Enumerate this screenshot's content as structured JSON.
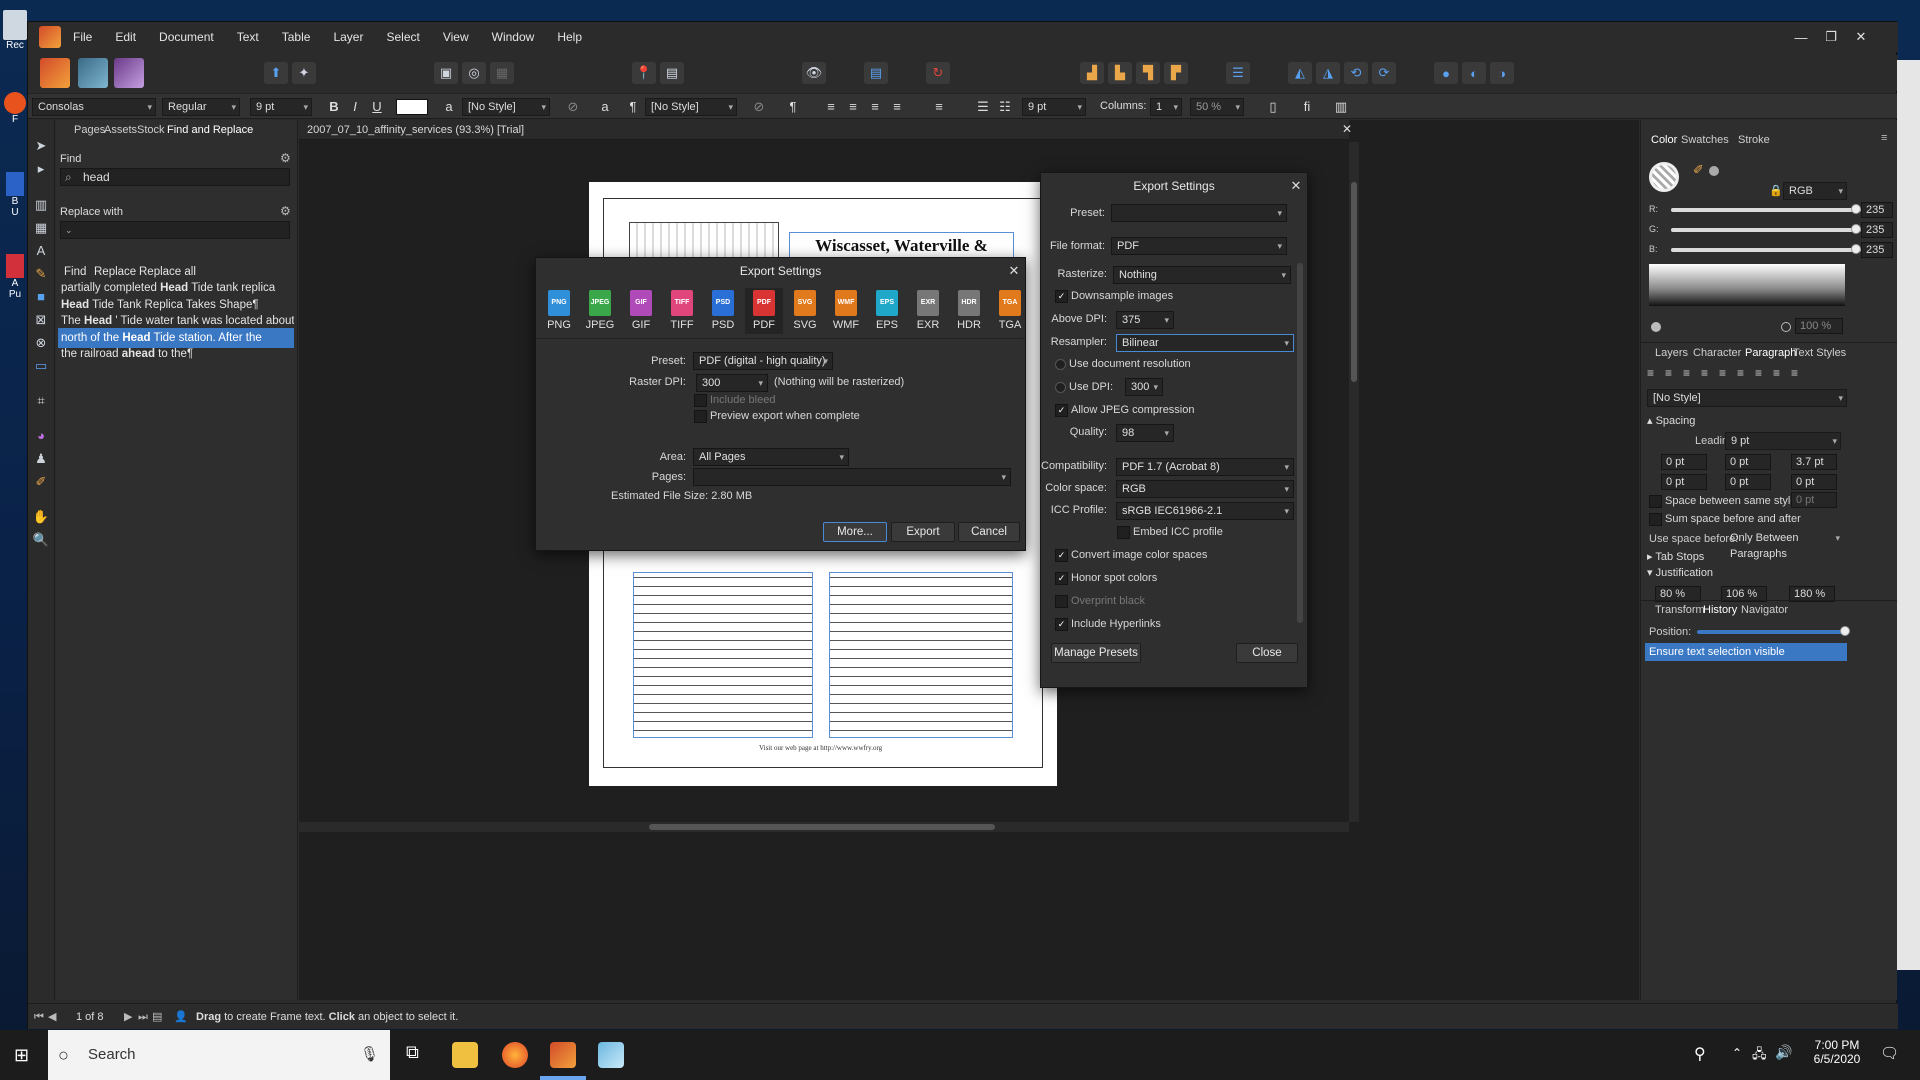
{
  "desktop": {
    "icons": [
      "Rec",
      "F",
      "B\nU",
      "A\nPu"
    ]
  },
  "app": {
    "menu": [
      "File",
      "Edit",
      "Document",
      "Text",
      "Table",
      "Layer",
      "Select",
      "View",
      "Window",
      "Help"
    ],
    "context": {
      "font": "Consolas",
      "style": "Regular",
      "size": "9 pt",
      "char_style": "[No Style]",
      "para_style": "[No Style]",
      "leading": "9 pt",
      "columns_label": "Columns:",
      "columns": "1",
      "gutter": "50 %"
    },
    "left_panel": {
      "tabs": [
        "Pages",
        "Assets",
        "Stock",
        "Find and Replace"
      ],
      "find_label": "Find",
      "find_value": "head",
      "replace_label": "Replace with",
      "buttons": [
        "Find",
        "Replace",
        "Replace all"
      ],
      "results": [
        {
          "pre": "partially completed ",
          "hit": "Head",
          "post": " Tide tank replica"
        },
        {
          "pre": "",
          "hit": "Head",
          "post": " Tide Tank Replica Takes Shape¶"
        },
        {
          "pre": "The ",
          "hit": "Head",
          "post": " ' Tide water tank was located about"
        },
        {
          "pre": "north of the ",
          "hit": "Head",
          "post": " Tide station. After the"
        },
        {
          "pre": "the railroad ",
          "hit": "ahead",
          "post": " to the¶"
        }
      ]
    },
    "document": {
      "tab_title": "2007_07_10_affinity_services (93.3%) [Trial]",
      "headline": "Wiscasset, Waterville & Farmington",
      "footer_line": "Visit our web page at http://www.wwfry.org"
    },
    "export_dialog": {
      "title": "Export Settings",
      "formats": [
        {
          "name": "PNG",
          "color": "#2f8fd9"
        },
        {
          "name": "JPEG",
          "color": "#3aa84a"
        },
        {
          "name": "GIF",
          "color": "#b04ab8"
        },
        {
          "name": "TIFF",
          "color": "#e0457b"
        },
        {
          "name": "PSD",
          "color": "#2a6fd6"
        },
        {
          "name": "PDF",
          "color": "#d93434"
        },
        {
          "name": "SVG",
          "color": "#e07a1c"
        },
        {
          "name": "WMF",
          "color": "#e0781c"
        },
        {
          "name": "EPS",
          "color": "#1fa8c8"
        },
        {
          "name": "EXR",
          "color": "#777777"
        },
        {
          "name": "HDR",
          "color": "#777777"
        },
        {
          "name": "TGA",
          "color": "#e07a1c"
        }
      ],
      "preset_label": "Preset:",
      "preset": "PDF (digital - high quality)",
      "raster_dpi_label": "Raster DPI:",
      "raster_dpi": "300",
      "raster_note": "(Nothing will be rasterized)",
      "include_bleed": "Include bleed",
      "preview": "Preview export when complete",
      "area_label": "Area:",
      "area": "All Pages",
      "pages_label": "Pages:",
      "file_size": "Estimated File Size: 2.80 MB",
      "more": "More...",
      "export": "Export",
      "cancel": "Cancel"
    },
    "more_dialog": {
      "title": "Export Settings",
      "preset_label": "Preset:",
      "file_format_label": "File format:",
      "file_format": "PDF",
      "rasterize_label": "Rasterize:",
      "rasterize": "Nothing",
      "downsample": "Downsample images",
      "above_dpi_label": "Above DPI:",
      "above_dpi": "375",
      "resampler_label": "Resampler:",
      "resampler": "Bilinear",
      "use_doc_res": "Use document resolution",
      "use_dpi_label": "Use DPI:",
      "use_dpi": "300",
      "allow_jpeg": "Allow JPEG compression",
      "quality_label": "Quality:",
      "quality": "98",
      "compat_label": "Compatibility:",
      "compat": "PDF 1.7 (Acrobat 8)",
      "color_space_label": "Color space:",
      "color_space": "RGB",
      "icc_label": "ICC Profile:",
      "icc": "sRGB IEC61966-2.1",
      "embed_icc": "Embed ICC profile",
      "convert_colors": "Convert image color spaces",
      "honor_spot": "Honor spot colors",
      "overprint": "Overprint black",
      "hyperlinks": "Include Hyperlinks",
      "manage_presets": "Manage Presets",
      "close": "Close"
    },
    "right_panel": {
      "color_tabs": [
        "Color",
        "Swatches",
        "Stroke"
      ],
      "color_model": "RGB",
      "r": "235",
      "g": "235",
      "b": "235",
      "opacity": "100 %",
      "para_tabs": [
        "Layers",
        "Character",
        "Paragraph",
        "Text Styles"
      ],
      "style": "[No Style]",
      "spacing": "Spacing",
      "leading_label": "Leading:",
      "leading": "9 pt",
      "indent_left": "0 pt",
      "indent_first": "0 pt",
      "indent_right": "3.7 pt",
      "space_before": "0 pt",
      "space_after": "0 pt",
      "baseline": "0 pt",
      "space_same_styles": "Space between same styles:",
      "space_same_value": "0 pt",
      "sum_space": "Sum space before and after",
      "use_space_before_label": "Use space before:",
      "use_space_before": "Only Between Paragraphs",
      "tab_stops": "Tab Stops",
      "justification": "Justification",
      "just_values": [
        "80 %",
        "106 %",
        "180 %"
      ],
      "history_tabs": [
        "Transform",
        "History",
        "Navigator"
      ],
      "position_label": "Position:",
      "history_item": "Ensure text selection visible"
    },
    "status": {
      "pages": "1 of 8",
      "drag": "Drag",
      "hint1": " to create Frame text. ",
      "click": "Click",
      "hint2": " an object to select it."
    }
  },
  "taskbar": {
    "search_placeholder": "Search",
    "time": "7:00 PM",
    "date": "6/5/2020"
  }
}
